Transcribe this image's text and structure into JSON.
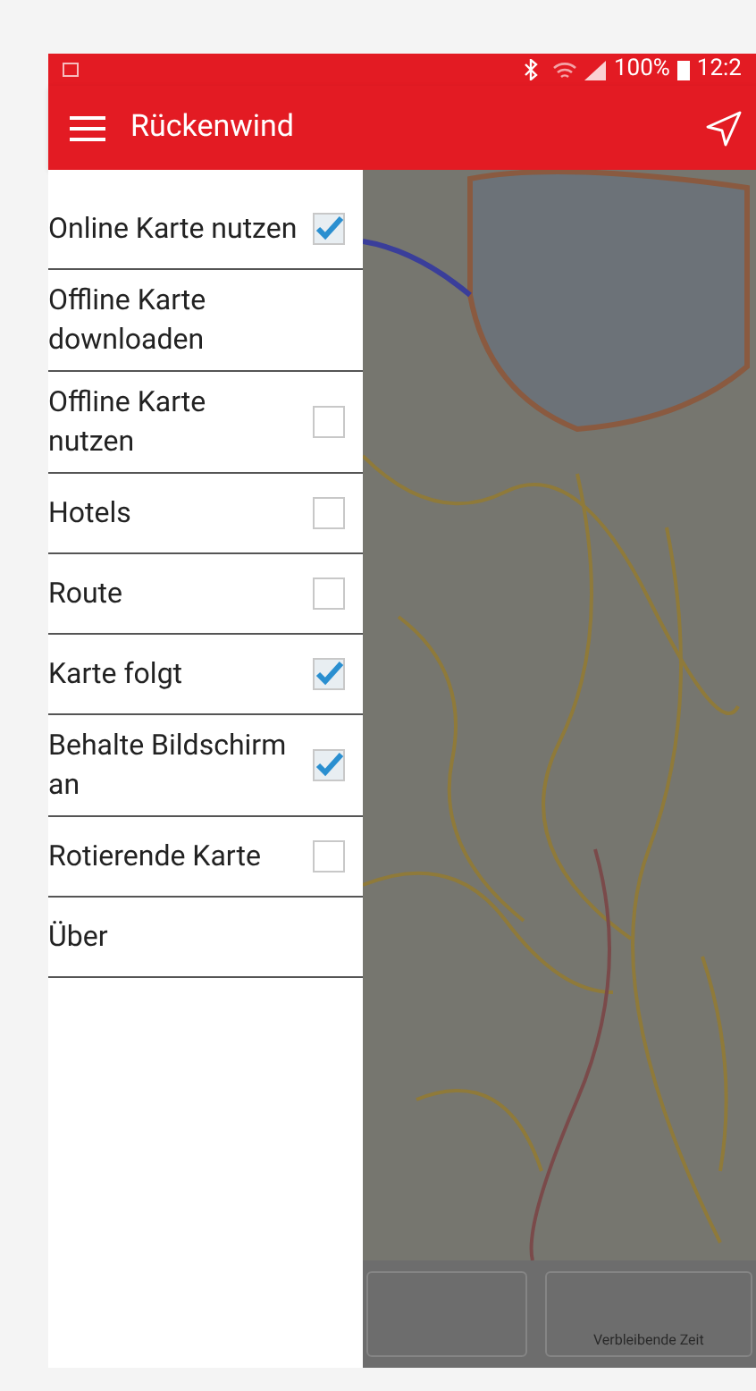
{
  "status_bar": {
    "battery": "100%",
    "time": "12:2"
  },
  "app_bar": {
    "title": "Rückenwind"
  },
  "drawer": {
    "items": [
      {
        "label": "Online Karte nutzen",
        "kind": "checkbox",
        "checked": true
      },
      {
        "label": "Offline Karte downloaden",
        "kind": "action"
      },
      {
        "label": "Offline Karte nutzen",
        "kind": "checkbox",
        "checked": false
      },
      {
        "label": "Hotels",
        "kind": "checkbox",
        "checked": false
      },
      {
        "label": "Route",
        "kind": "checkbox",
        "checked": false
      },
      {
        "label": "Karte folgt",
        "kind": "checkbox",
        "checked": true
      },
      {
        "label": "Behalte Bildschirm an",
        "kind": "checkbox",
        "checked": true
      },
      {
        "label": "Rotierende Karte",
        "kind": "checkbox",
        "checked": false
      },
      {
        "label": "Über",
        "kind": "action"
      }
    ]
  },
  "info_panel": {
    "cards": [
      {
        "kind": "empty"
      },
      {
        "kind": "label",
        "label": "Verbleibende Zeit"
      }
    ]
  }
}
